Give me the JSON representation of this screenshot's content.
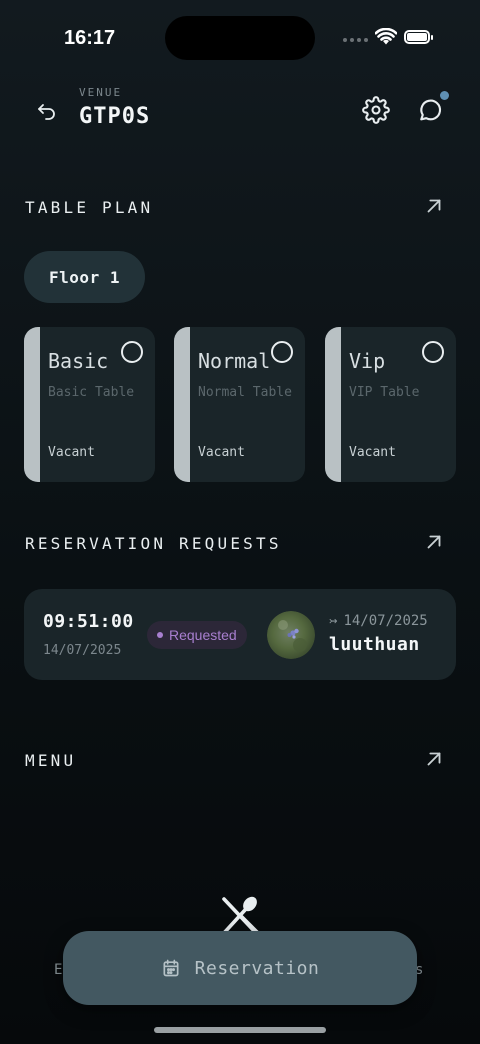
{
  "status_bar": {
    "time": "16:17"
  },
  "header": {
    "venue_label": "VENUE",
    "venue_name": "GTP0S"
  },
  "sections": {
    "table_plan": "TABLE PLAN",
    "reservation_requests": "RESERVATION REQUESTS",
    "menu": "MENU"
  },
  "floor_chip": "Floor 1",
  "tables": [
    {
      "name": "Basic",
      "description": "Basic Table",
      "status": "Vacant"
    },
    {
      "name": "Normal",
      "description": "Normal Table",
      "status": "Vacant"
    },
    {
      "name": "Vip",
      "description": "VIP Table",
      "status": "Vacant"
    }
  ],
  "reservation": {
    "time": "09:51:00",
    "date": "14/07/2025",
    "status": "Requested",
    "to_date": "14/07/2025",
    "user": "luuthuan"
  },
  "bottom": {
    "tab_left": "E",
    "tab_right": "s",
    "action_label": "Reservation"
  },
  "colors": {
    "background": "#0b1114",
    "card": "#1a2529",
    "requested_badge": "#a87fcf",
    "notification_dot": "#5f90b4",
    "action_button": "#435861"
  },
  "icons": {
    "back": "undo-arrow-icon",
    "settings": "gear-icon",
    "chat": "chat-bubble-icon",
    "expand": "arrow-up-right-icon",
    "calendar": "calendar-icon",
    "utensils": "fork-knife-icon"
  }
}
